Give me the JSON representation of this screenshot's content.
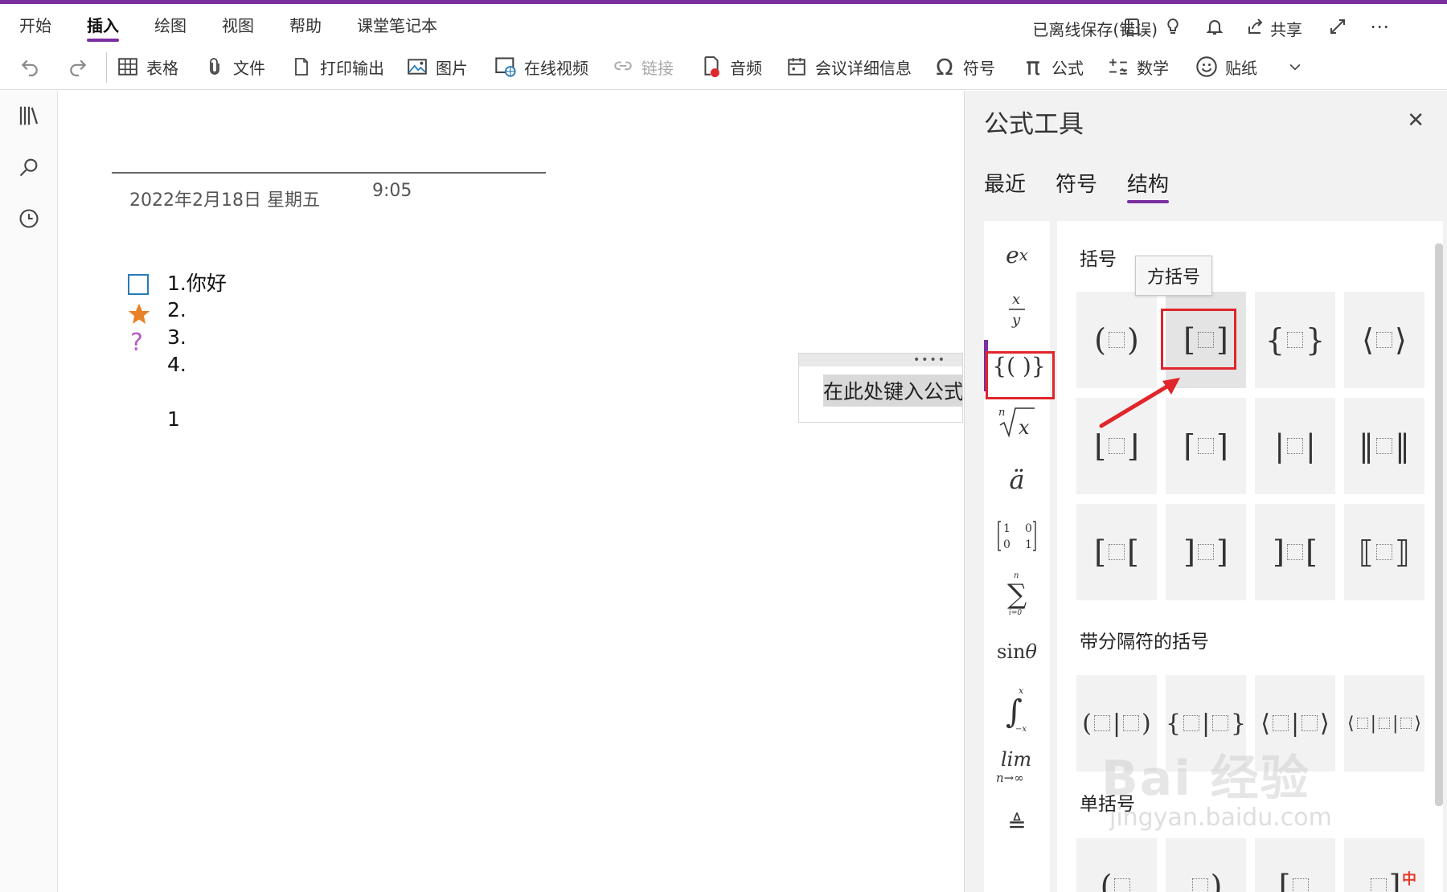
{
  "ribbon": {
    "tabs": [
      "开始",
      "插入",
      "绘图",
      "视图",
      "帮助",
      "课堂笔记本"
    ],
    "active_tab": "插入",
    "status": "已离线保存(错误)",
    "share_label": "共享"
  },
  "toolbar": {
    "table": "表格",
    "file": "文件",
    "printout": "打印输出",
    "picture": "图片",
    "online_video": "在线视频",
    "link": "链接",
    "audio": "音频",
    "meeting_details": "会议详细信息",
    "symbol": "符号",
    "equation": "公式",
    "math": "数学",
    "sticker": "贴纸"
  },
  "page": {
    "date": "2022年2月18日 星期五",
    "time": "9:05",
    "lines": [
      "1.你好",
      "2.",
      "3.",
      "4.",
      "1"
    ],
    "equation_placeholder": "在此处键入公式"
  },
  "equation_pane": {
    "title": "公式工具",
    "tabs": [
      "最近",
      "符号",
      "结构"
    ],
    "active_tab": "结构",
    "sections": {
      "brackets": "括号",
      "brackets_with_separators": "带分隔符的括号",
      "single_brackets": "单括号"
    },
    "tooltip": "方括号"
  },
  "watermark": {
    "brand": "Bai 经验",
    "url": "jingyan.baidu.com"
  },
  "ime": "中",
  "colors": {
    "accent": "#7a2f9e",
    "highlight_box": "#e0252b",
    "arrow": "#e0252b",
    "star_tag": "#e8832a",
    "question_tag": "#b55ec4",
    "todo_tag": "#2a7ab8"
  },
  "icons": [
    "undo-icon",
    "redo-icon",
    "table-icon",
    "paperclip-icon",
    "document-icon",
    "picture-icon",
    "online-video-icon",
    "link-icon",
    "audio-icon",
    "calendar-icon",
    "omega-icon",
    "pi-icon",
    "math-icon",
    "smiley-icon",
    "chevron-down-icon",
    "notebooks-icon",
    "search-icon",
    "recent-icon",
    "close-icon"
  ]
}
